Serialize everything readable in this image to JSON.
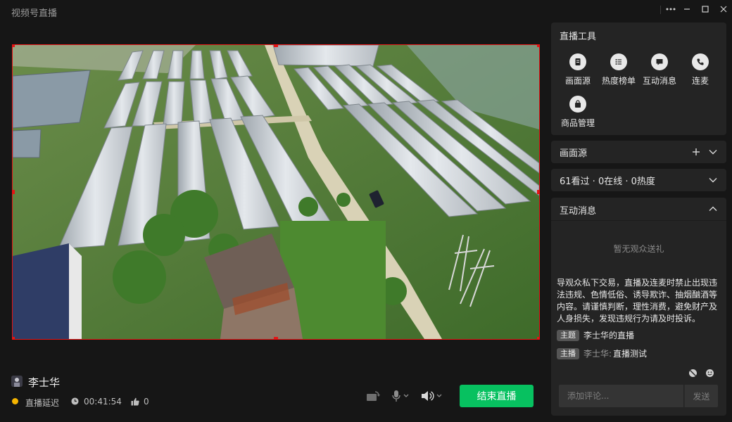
{
  "window": {
    "title": "视频号直播"
  },
  "tools": {
    "title": "直播工具",
    "items": [
      {
        "label": "画面源",
        "icon": "document-icon"
      },
      {
        "label": "热度榜单",
        "icon": "list-icon"
      },
      {
        "label": "互动消息",
        "icon": "chat-icon"
      },
      {
        "label": "连麦",
        "icon": "phone-icon"
      },
      {
        "label": "商品管理",
        "icon": "shopping-bag-icon"
      }
    ]
  },
  "sections": {
    "source_title": "画面源",
    "stats": "61看过 · 0在线 · 0热度",
    "interact_title": "互动消息"
  },
  "interact": {
    "empty_gift": "暂无观众送礼",
    "notice": "导观众私下交易，直播及连麦时禁止出现违法违规、色情低俗、诱导欺诈、抽烟酗酒等内容。请谨慎判断，理性消费，避免财产及人身损失，发现违规行为请及时投诉。",
    "messages": [
      {
        "tag": "主题",
        "author": "",
        "text": "李士华的直播"
      },
      {
        "tag": "主播",
        "author": "李士华:",
        "text": "直播测试"
      }
    ],
    "input_placeholder": "添加评论...",
    "send_label": "发送"
  },
  "footer": {
    "username": "李士华",
    "status": "直播延迟",
    "duration": "00:41:54",
    "likes": "0",
    "end_label": "结束直播"
  },
  "colors": {
    "accent": "#07c160",
    "border": "#e61414",
    "status": "#f5b400"
  }
}
